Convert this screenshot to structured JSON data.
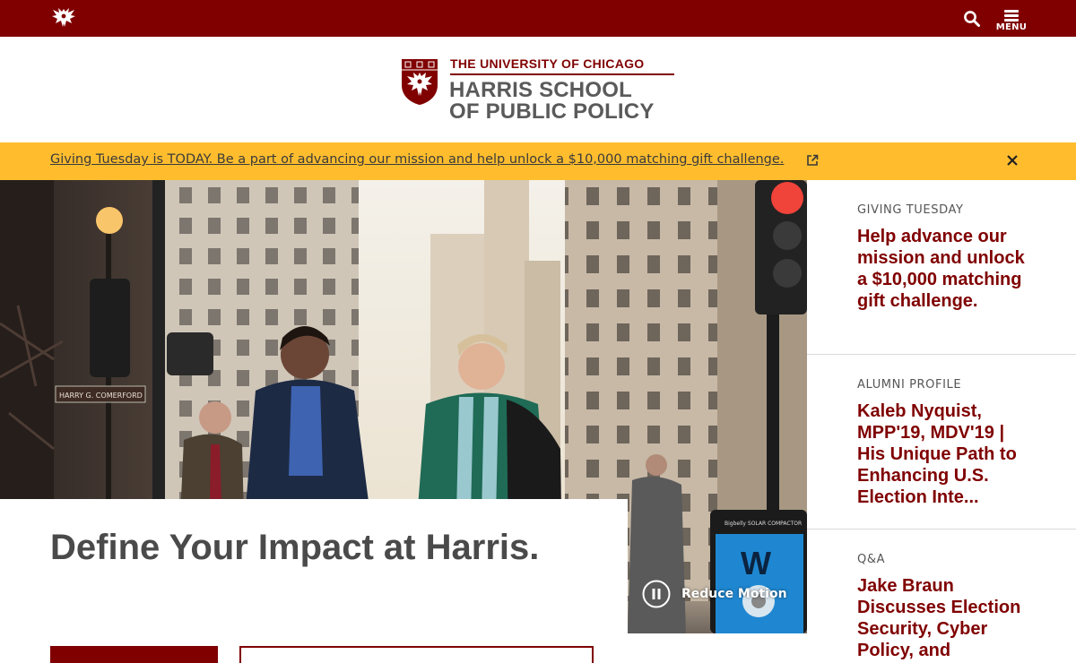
{
  "topbar": {
    "menu_label": "MENU",
    "icons": [
      "phoenix-icon",
      "search-icon",
      "menu-icon"
    ]
  },
  "logo": {
    "university": "THE UNIVERSITY OF CHICAGO",
    "school_line1": "HARRIS SCHOOL",
    "school_line2": "OF PUBLIC POLICY"
  },
  "alert": {
    "text": "Giving Tuesday is TODAY. Be a part of advancing our mission and help unlock a $10,000 matching gift challenge.",
    "icons": [
      "external-link-icon",
      "close-icon"
    ]
  },
  "hero": {
    "title": "Define Your Impact at Harris.",
    "reduce_motion_label": "Reduce Motion",
    "street_sign": "HARRY G. COMERFORD",
    "compactor_label": "Bigbelly SOLAR COMPACTOR"
  },
  "side": {
    "items": [
      {
        "kicker": "GIVING TUESDAY",
        "headline": "Help advance our mission and unlock a $10,000 matching gift challenge."
      },
      {
        "kicker": "ALUMNI PROFILE",
        "headline": "Kaleb Nyquist, MPP'19, MDV'19 | His Unique Path to Enhancing U.S. Election Inte..."
      },
      {
        "kicker": "Q&A",
        "headline": "Jake Braun Discusses Election Security, Cyber Policy, and"
      }
    ]
  },
  "colors": {
    "maroon": "#800000",
    "alert_yellow": "#ffbd2e",
    "text_gray": "#4a4a4a"
  }
}
